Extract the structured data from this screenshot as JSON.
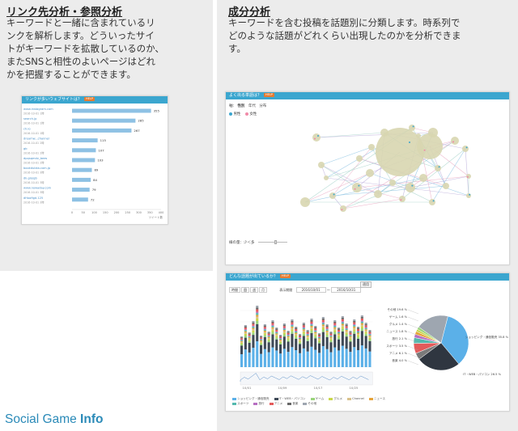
{
  "left": {
    "title": "リンク先分析・参照分析",
    "desc_lines": [
      "キーワードと一緒に含まれているリ",
      "ンクを解析します。どういったサイ",
      "トがキーワードを拡散しているのか、",
      "またSNSと相性のよいページはどれ",
      "かを把握することができます。"
    ]
  },
  "right": {
    "title": "成分分析",
    "desc_lines": [
      "キーワードを含む投稿を話題別に分類します。時系列で",
      "どのような話題がどれくらい出現したのかを分析できま",
      "す。"
    ]
  },
  "brand": {
    "part1": "Social Game ",
    "part2": "Info"
  },
  "link_panel": {
    "header": "リンクが多いウェブサイトは？",
    "help": "HELP",
    "colors": {
      "bar": "#8ec1e4",
      "link": "#4a90c8"
    },
    "chart_data": {
      "type": "bar",
      "orientation": "horizontal",
      "categories": [
        "www.instagram.com",
        "2016-10-01 1時",
        "search.jp",
        "2016-10-01 1時",
        "ch.io",
        "2016-10-01 1時",
        "dreamw...channel",
        "2016-10-01 2時",
        "gb",
        "2016-10-01 2時",
        "dpqsqmdv_bees",
        "2016-10-01 2時",
        "bookdubka.com.jp",
        "2016-10-01 3時",
        "dk.gio/gb",
        "2016-10-01 3時",
        "www.nowaday.com",
        "2016-10-01 3時",
        "dHoofigd.125",
        "2016-10-01 3時"
      ],
      "values": [
        355,
        285,
        267,
        115,
        107,
        103,
        89,
        84,
        79,
        72
      ],
      "x_ticks": [
        "0",
        "50",
        "100",
        "150",
        "200",
        "250",
        "300",
        "350",
        "400"
      ],
      "xlim": [
        0,
        400
      ],
      "xunit": "ツイート数"
    }
  },
  "network_panel": {
    "header": "よく出る単語は？",
    "help": "HELP",
    "tabs": [
      "性別",
      "年代",
      "分布"
    ],
    "tab_prefix": "軸：",
    "legend": [
      {
        "label": "男性",
        "color": "#3ba6cf"
      },
      {
        "label": "女性",
        "color": "#f08aa8"
      }
    ],
    "slider_label": "線の量：少＜多"
  },
  "topic_panel": {
    "header": "どんな話題が出ているか？",
    "help": "HELP",
    "granularity": [
      "時間",
      "日",
      "週",
      "月"
    ],
    "date_label": "表示期間",
    "date_from": "2016/10/01",
    "date_sep": "〜",
    "date_to": "2016/10/31",
    "apply": "適用",
    "xlabels": [
      "10/01",
      "10/09",
      "10/17",
      "10/25"
    ],
    "legend": [
      {
        "label": "ショッピング・通信販売",
        "color": "#5bb0e8"
      },
      {
        "label": "IT・WEB・パソコン",
        "color": "#3f4a57"
      },
      {
        "label": "ゲーム",
        "color": "#9ad47c"
      },
      {
        "label": "グルメ",
        "color": "#c9d64a"
      },
      {
        "label": "Channel",
        "color": "#d9c18b"
      },
      {
        "label": "ニュース",
        "color": "#e6a33a"
      },
      {
        "label": "スポーツ",
        "color": "#54b9ae"
      },
      {
        "label": "旅行",
        "color": "#b76fc2"
      },
      {
        "label": "アニメ",
        "color": "#e35a5a"
      },
      {
        "label": "音楽",
        "color": "#666666"
      },
      {
        "label": "その他",
        "color": "#9ea6b0"
      }
    ],
    "pie_labels": [
      {
        "text": "その他 19.6 %",
        "side": "left"
      },
      {
        "text": "ゲーム 1.6 %",
        "side": "left"
      },
      {
        "text": "グルメ 1.4 %",
        "side": "left"
      },
      {
        "text": "ニュース 1.8 %",
        "side": "left"
      },
      {
        "text": "旅行 2.1 %",
        "side": "left"
      },
      {
        "text": "スポーツ 3.5 %",
        "side": "left"
      },
      {
        "text": "アニメ 6.1 %",
        "side": "left"
      },
      {
        "text": "音楽 4.0 %",
        "side": "left"
      },
      {
        "text": "ショッピング・通信販売 35.8 %",
        "side": "right"
      },
      {
        "text": "IT・WEB・パソコン 26.5 %",
        "side": "right"
      }
    ],
    "chart_data": {
      "type": "pie",
      "slices": [
        {
          "label": "ショッピング・通信販売",
          "value": 35.8,
          "color": "#5bb0e8"
        },
        {
          "label": "IT・WEB・パソコン",
          "value": 26.5,
          "color": "#2f3640"
        },
        {
          "label": "音楽",
          "value": 4.0,
          "color": "#7a7a7a"
        },
        {
          "label": "アニメ",
          "value": 6.1,
          "color": "#e35a5a"
        },
        {
          "label": "スポーツ",
          "value": 3.5,
          "color": "#54b9ae"
        },
        {
          "label": "旅行",
          "value": 2.1,
          "color": "#b76fc2"
        },
        {
          "label": "ニュース",
          "value": 1.8,
          "color": "#e6a33a"
        },
        {
          "label": "グルメ",
          "value": 1.4,
          "color": "#c9d64a"
        },
        {
          "label": "ゲーム",
          "value": 1.6,
          "color": "#9ad47c"
        },
        {
          "label": "その他",
          "value": 19.6,
          "color": "#9ea6b0"
        }
      ]
    }
  }
}
